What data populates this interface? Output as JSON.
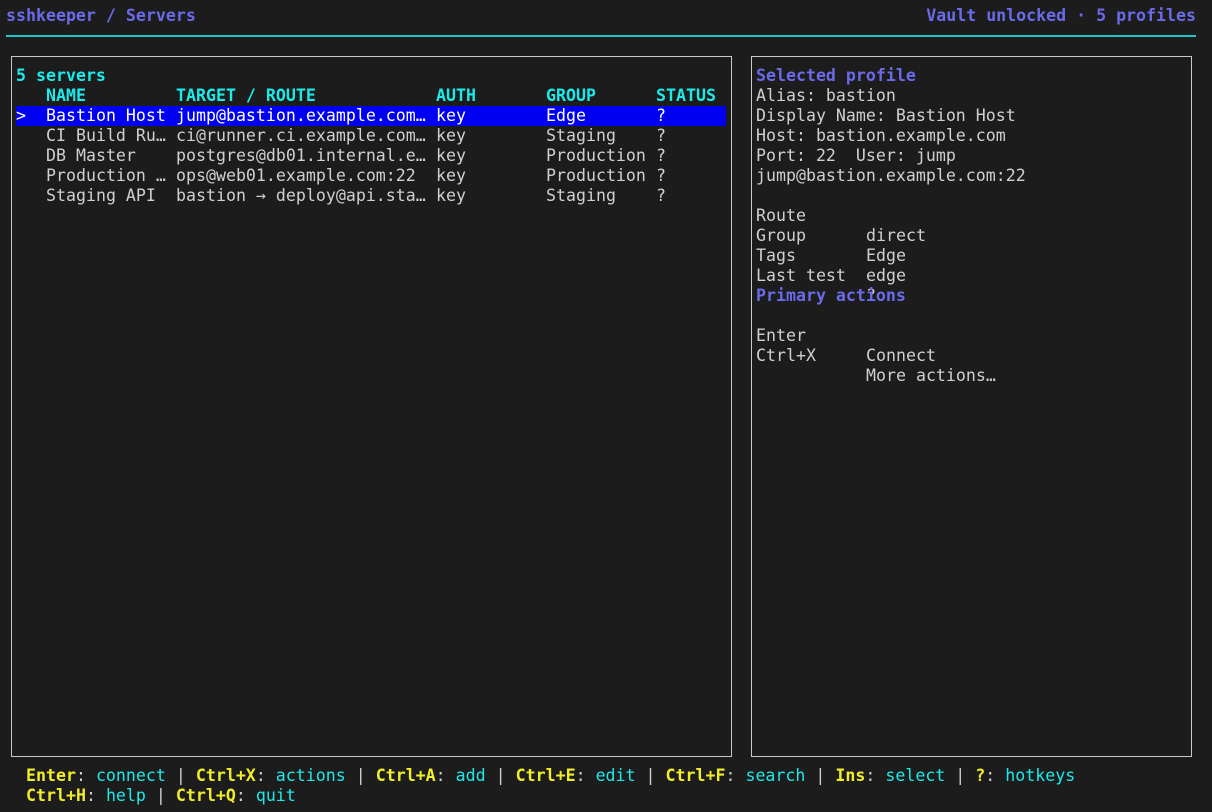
{
  "header": {
    "breadcrumb": "sshkeeper / Servers",
    "vault_status": "Vault unlocked · 5 profiles"
  },
  "server_list": {
    "count_label": "5 servers",
    "columns": {
      "name": "NAME",
      "target": "TARGET / ROUTE",
      "auth": "AUTH",
      "group": "GROUP",
      "status": "STATUS"
    },
    "cursor": ">",
    "rows": [
      {
        "name": "Bastion Host",
        "target": "jump@bastion.example.com…",
        "auth": "key",
        "group": "Edge",
        "status": "?",
        "selected": true
      },
      {
        "name": "CI Build Ru…",
        "target": "ci@runner.ci.example.com…",
        "auth": "key",
        "group": "Staging",
        "status": "?",
        "selected": false
      },
      {
        "name": "DB Master",
        "target": "postgres@db01.internal.e…",
        "auth": "key",
        "group": "Production",
        "status": "?",
        "selected": false
      },
      {
        "name": "Production …",
        "target": "ops@web01.example.com:22",
        "auth": "key",
        "group": "Production",
        "status": "?",
        "selected": false
      },
      {
        "name": "Staging API",
        "target": "bastion → deploy@api.sta…",
        "auth": "key",
        "group": "Staging",
        "status": "?",
        "selected": false
      }
    ]
  },
  "detail": {
    "heading": "Selected profile",
    "alias_line": "Alias: bastion",
    "display_name_line": "Display Name: Bastion Host",
    "host_line": "Host: bastion.example.com",
    "port_user_line": "Port: 22  User: jump",
    "target_line": "jump@bastion.example.com:22",
    "fields": [
      {
        "key": "Route",
        "value": "direct"
      },
      {
        "key": "Group",
        "value": "Edge"
      },
      {
        "key": "Tags",
        "value": "edge"
      },
      {
        "key": "Last test",
        "value": "?"
      }
    ],
    "actions_heading": "Primary actions",
    "actions": [
      {
        "key": "Enter",
        "value": "Connect"
      },
      {
        "key": "Ctrl+X",
        "value": "More actions…"
      }
    ]
  },
  "footer": {
    "separator": " | ",
    "colon": ": ",
    "hotkeys_line1": [
      {
        "key": "Enter",
        "label": "connect"
      },
      {
        "key": "Ctrl+X",
        "label": "actions"
      },
      {
        "key": "Ctrl+A",
        "label": "add"
      },
      {
        "key": "Ctrl+E",
        "label": "edit"
      },
      {
        "key": "Ctrl+F",
        "label": "search"
      },
      {
        "key": "Ins",
        "label": "select"
      },
      {
        "key": "?",
        "label": "hotkeys"
      }
    ],
    "hotkeys_line2": [
      {
        "key": "Ctrl+H",
        "label": "help"
      },
      {
        "key": "Ctrl+Q",
        "label": "quit"
      }
    ]
  },
  "colors": {
    "background": "#1c1c1c",
    "title_purple": "#6b6bea",
    "header_cyan": "#1de9e9",
    "hotkey_yellow": "#f0ee2a",
    "selection_blue": "#0000f0"
  }
}
